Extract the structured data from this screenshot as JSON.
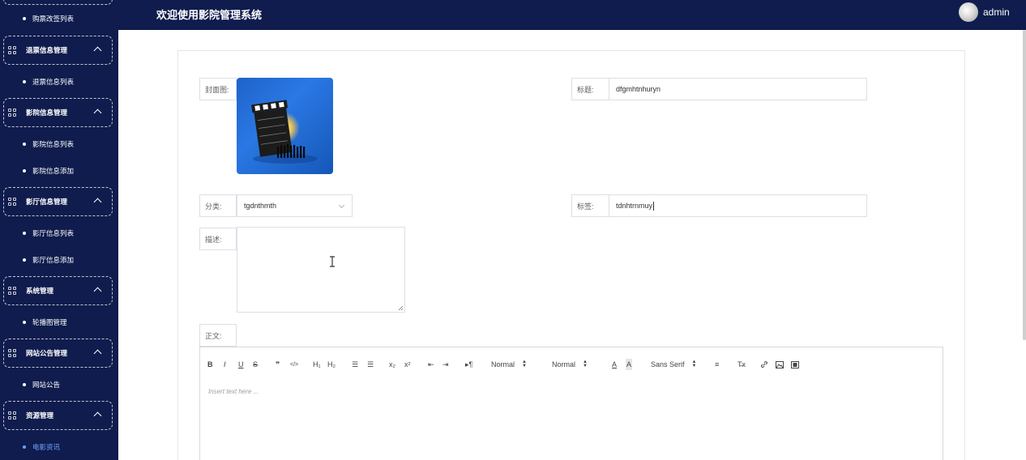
{
  "header": {
    "title": "欢迎使用影院管理系统",
    "user": "admin"
  },
  "sidebar": {
    "items": [
      {
        "type": "sub",
        "label": "购票改签列表"
      },
      {
        "type": "group",
        "label": "退票信息管理"
      },
      {
        "type": "sub",
        "label": "退票信息列表"
      },
      {
        "type": "group",
        "label": "影院信息管理"
      },
      {
        "type": "sub",
        "label": "影院信息列表"
      },
      {
        "type": "sub",
        "label": "影院信息添加"
      },
      {
        "type": "group",
        "label": "影厅信息管理"
      },
      {
        "type": "sub",
        "label": "影厅信息列表"
      },
      {
        "type": "sub",
        "label": "影厅信息添加"
      },
      {
        "type": "group",
        "label": "系统管理"
      },
      {
        "type": "sub",
        "label": "轮播图管理"
      },
      {
        "type": "group",
        "label": "网站公告管理"
      },
      {
        "type": "sub",
        "label": "网站公告"
      },
      {
        "type": "group",
        "label": "资源管理"
      },
      {
        "type": "sub",
        "label": "电影资讯",
        "active": true
      }
    ]
  },
  "form": {
    "cover_label": "封面图:",
    "title_label": "标题:",
    "title_value": "dfgmhtnhuryn",
    "category_label": "分类:",
    "category_value": "tgdnthmth",
    "tag_label": "标签:",
    "tag_value": "tdnhtrnmuy",
    "description_label": "描述:",
    "body_label": "正文:"
  },
  "editor": {
    "placeholder": "Insert text here ...",
    "toolbar": {
      "bold": "B",
      "italic": "I",
      "underline": "U",
      "strike": "S",
      "quote": "❞",
      "code": "</>",
      "h1": "H₁",
      "h2": "H₂",
      "ordered_list": "☰",
      "bullet_list": "☰",
      "subscript": "x₂",
      "superscript": "x²",
      "outdent": "⇤",
      "indent": "⇥",
      "direction": "▸¶",
      "size_picker": "Normal",
      "header_picker": "Normal",
      "color": "A",
      "background": "A",
      "font_picker": "Sans Serif",
      "align": "≡",
      "clean": "T̶x",
      "link": "🔗",
      "image": "▣",
      "video": "▤"
    }
  }
}
